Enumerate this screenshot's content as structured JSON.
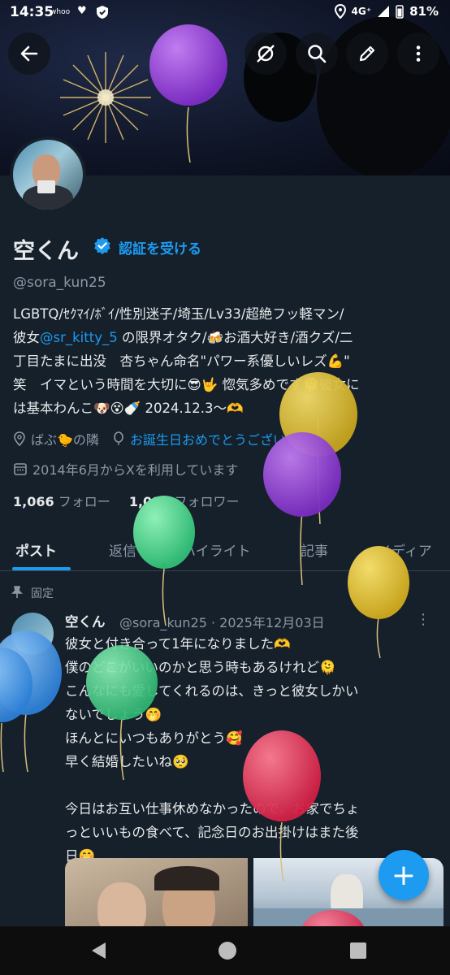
{
  "status": {
    "time": "14:35",
    "carrier": "whoo",
    "network": "4G⁺",
    "battery": "81%"
  },
  "profile": {
    "name": "空くん",
    "get_verified": "認証を受ける",
    "handle": "@sora_kun25",
    "bio_line1": "LGBTQ/ｾｸﾏｲ/ﾎﾞｲ/性別迷子/埼玉/Lv33/超絶フッ軽マン/",
    "bio_line2_pre": "彼女",
    "bio_mention": "@sr_kitty_5",
    "bio_line2_post": "の限界オタク/🍻お酒大好き/酒クズ/二",
    "bio_line3": "丁目たまに出没　杏ちゃん命名\"パワー系優しいレズ💪\"",
    "bio_line4": "笑　イマという時間を大切に😎🤟 惚気多めです🫠彼女に",
    "bio_line5": "は基本わんこ🐶😵🍼 2024.12.3〜🫶",
    "location": "ばぶ🐤の隣",
    "birthday": "お誕生日おめでとうございます。",
    "joined": "2014年6月からXを利用しています",
    "following_count": "1,066",
    "following_label": "フォロー",
    "followers_count": "1,083",
    "followers_label": "フォロワー"
  },
  "tabs": [
    "ポスト",
    "返信",
    "ハイライト",
    "記事",
    "メディア"
  ],
  "tweet": {
    "pinned_label": "固定",
    "name": "空くん",
    "meta": "@sora_kun25 · 2025年12月03日",
    "lines": [
      "彼女と付き合って1年になりました🫶",
      "僕のどこがいいのかと思う時もあるけれど🫠",
      "こんなにも愛してくれるのは、きっと彼女しかい",
      "ないでしょう🤭",
      "ほんとにいつもありがとう🥰",
      "早く結婚したいね🥺",
      "",
      "今日はお互い仕事休めなかったので、お家でちょ",
      "っといいもの食べて、記念日のお出掛けはまた後",
      "日🤭"
    ]
  },
  "icons": {
    "back": "back-arrow-icon",
    "grok": "grok-icon",
    "search": "search-icon",
    "edit": "edit-icon",
    "more": "more-vertical-icon",
    "compose": "plus-icon"
  },
  "colors": {
    "background": "#15202b",
    "accent": "#1d9bf0",
    "secondary_text": "#8b98a5"
  }
}
